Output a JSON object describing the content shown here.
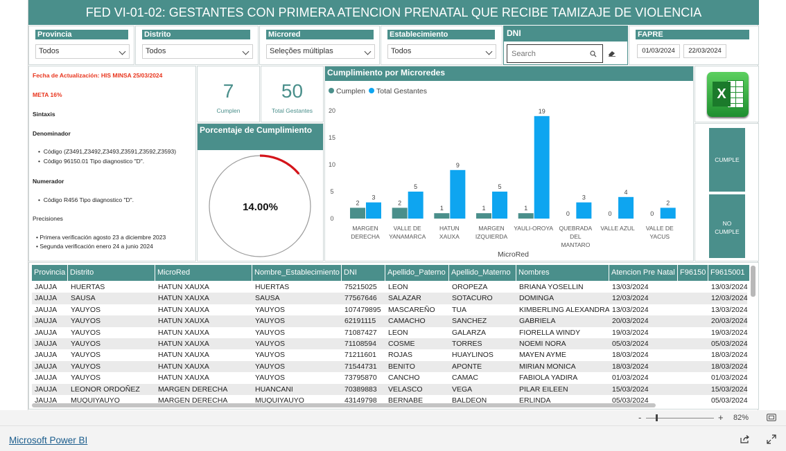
{
  "report_title": "FED VI-01-02: GESTANTES CON PRIMERA ATENCION PRENATAL QUE RECIBE TAMIZAJE DE VIOLENCIA",
  "slicers": {
    "provincia": {
      "label": "Provincia",
      "value": "Todos"
    },
    "distrito": {
      "label": "Distrito",
      "value": "Todos"
    },
    "microred": {
      "label": "Microred",
      "value": "Seleções múltiplas"
    },
    "establecimiento": {
      "label": "Establecimiento",
      "value": "Todos"
    },
    "dni": {
      "label": "DNI",
      "placeholder": "Search"
    },
    "fapre": {
      "label": "FAPRE",
      "from": "01/03/2024",
      "to": "22/03/2024"
    }
  },
  "info": {
    "fecha": "Fecha de Actualización: HIS MINSA  25/03/2024",
    "meta": "META 16%",
    "sintaxis": "Sintaxis",
    "denominador": "Denominador",
    "den1": "Código (Z3491,Z3492,Z3493,Z3591,Z3592,Z3593)",
    "den2": "Código 96150.01 Tipo diagnostico \"D\".",
    "numerador": "Numerador",
    "num1": "Código R456 Tipo diagnostico \"D\".",
    "precisiones": "Precisiones",
    "pre1": "Primera verificación agosto 23 a diciembre 2023",
    "pre2": "Segunda verificación enero 24 a junio 2024"
  },
  "kpi": {
    "cumplen_value": "7",
    "cumplen_label": "Cumplen",
    "total_value": "50",
    "total_label": "Total Gestantes"
  },
  "gauge": {
    "title": "Porcentaje de Cumplimiento",
    "value_text": "14.00%",
    "value": 0.14
  },
  "buttons": {
    "cumple": "CUMPLE",
    "no_cumple_1": "NO",
    "no_cumple_2": "CUMPLE"
  },
  "chart_data": {
    "type": "bar",
    "title": "Cumplimiento por Microredes",
    "xlabel": "MicroRed",
    "ylabel": "",
    "ylim": [
      0,
      20
    ],
    "yticks": [
      "0",
      "5",
      "10",
      "15",
      "20"
    ],
    "categories": [
      "MARGEN DERECHA",
      "VALLE DE YANAMARCA",
      "HATUN XAUXA",
      "MARGEN IZQUIERDA",
      "YAULI-OROYA",
      "QUEBRADA DEL MANTARO",
      "VALLE AZUL",
      "VALLE DE YACUS"
    ],
    "category_lines": [
      [
        "MARGEN",
        "DERECHA"
      ],
      [
        "VALLE DE",
        "YANAMARCA"
      ],
      [
        "HATUN",
        "XAUXA"
      ],
      [
        "MARGEN",
        "IZQUIERDA"
      ],
      [
        "YAULI-OROYA"
      ],
      [
        "QUEBRADA",
        "DEL",
        "MANTARO"
      ],
      [
        "VALLE AZUL"
      ],
      [
        "VALLE DE",
        "YACUS"
      ]
    ],
    "series": [
      {
        "name": "Cumplen",
        "color": "#4a8f8b",
        "values": [
          2,
          2,
          1,
          1,
          1,
          0,
          0,
          0
        ]
      },
      {
        "name": "Total Gestantes",
        "color": "#0ea5f0",
        "values": [
          3,
          5,
          9,
          5,
          19,
          3,
          4,
          2
        ]
      }
    ],
    "legend": "top-left"
  },
  "table": {
    "columns": [
      "Provincia",
      "Distrito",
      "MicroRed",
      "Nombre_Establecimiento",
      "DNI",
      "Apellido_Paterno",
      "Apellido_Materno",
      "Nombres",
      "Atencion Pre Natal",
      "F96150",
      "F9615001"
    ],
    "rows": [
      [
        "JAUJA",
        "HUERTAS",
        "HATUN XAUXA",
        "HUERTAS",
        "75215025",
        "LEON",
        "OROPEZA",
        "BRIANA YOSELLIN",
        "13/03/2024",
        "",
        "13/03/2024"
      ],
      [
        "JAUJA",
        "SAUSA",
        "HATUN XAUXA",
        "SAUSA",
        "77567646",
        "SALAZAR",
        "SOTACURO",
        "DOMINGA",
        "12/03/2024",
        "",
        "12/03/2024"
      ],
      [
        "JAUJA",
        "YAUYOS",
        "HATUN XAUXA",
        "YAUYOS",
        "107479895",
        "MASCAREÑO",
        "TUA",
        "KIMBERLING ALEXANDRA",
        "13/03/2024",
        "",
        "13/03/2024"
      ],
      [
        "JAUJA",
        "YAUYOS",
        "HATUN XAUXA",
        "YAUYOS",
        "62191115",
        "CAMACHO",
        "SANCHEZ",
        "GABRIELA",
        "20/03/2024",
        "",
        "20/03/2024"
      ],
      [
        "JAUJA",
        "YAUYOS",
        "HATUN XAUXA",
        "YAUYOS",
        "71087427",
        "LEON",
        "GALARZA",
        "FIORELLA WINDY",
        "19/03/2024",
        "",
        "19/03/2024"
      ],
      [
        "JAUJA",
        "YAUYOS",
        "HATUN XAUXA",
        "YAUYOS",
        "71108594",
        "COSME",
        "TORRES",
        "NOEMI NORA",
        "05/03/2024",
        "",
        "05/03/2024"
      ],
      [
        "JAUJA",
        "YAUYOS",
        "HATUN XAUXA",
        "YAUYOS",
        "71211601",
        "ROJAS",
        "HUAYLINOS",
        "MAYEN AYME",
        "18/03/2024",
        "",
        "18/03/2024"
      ],
      [
        "JAUJA",
        "YAUYOS",
        "HATUN XAUXA",
        "YAUYOS",
        "71544731",
        "BENITO",
        "APONTE",
        "MIRIAN MONICA",
        "18/03/2024",
        "",
        "18/03/2024"
      ],
      [
        "JAUJA",
        "YAUYOS",
        "HATUN XAUXA",
        "YAUYOS",
        "73795870",
        "CANCHO",
        "CAMAC",
        "FABIOLA YADIRA",
        "01/03/2024",
        "",
        "01/03/2024"
      ],
      [
        "JAUJA",
        "LEONOR ORDOÑEZ",
        "MARGEN DERECHA",
        "HUANCANI",
        "70389883",
        "VELASCO",
        "VEGA",
        "PILAR EILEEN",
        "15/03/2024",
        "",
        "15/03/2024"
      ],
      [
        "JAUJA",
        "MUQUIYAUYO",
        "MARGEN DERECHA",
        "MUQUIYAUYO",
        "43149798",
        "BERNABE",
        "BALDEON",
        "ERLINDA",
        "05/03/2024",
        "",
        "05/03/2024"
      ]
    ]
  },
  "zoom": {
    "minus": "-",
    "plus": "+",
    "value": "82%",
    "level": 0.55
  },
  "footer": {
    "brand": "Microsoft Power BI"
  }
}
